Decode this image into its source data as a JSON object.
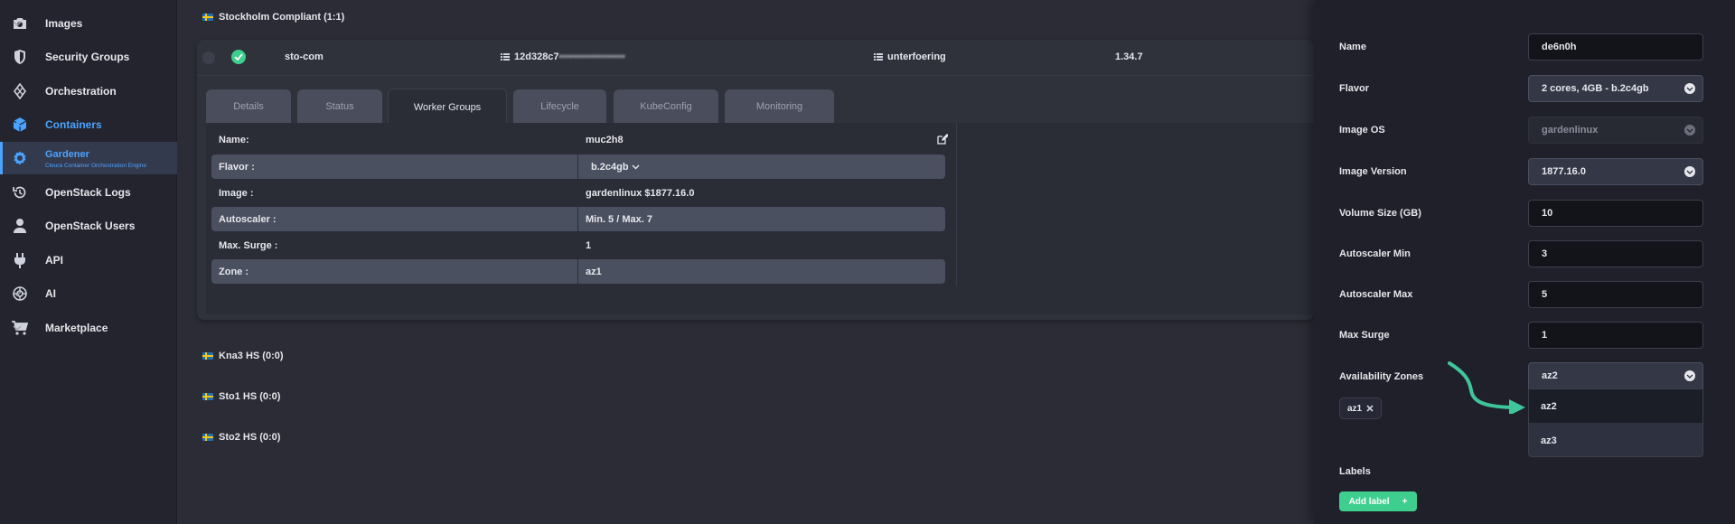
{
  "sidebar": {
    "items": [
      {
        "label": "Images",
        "icon": "camera-icon",
        "chevron": "down"
      },
      {
        "label": "Security Groups",
        "icon": "shield-icon"
      },
      {
        "label": "Orchestration",
        "icon": "orchestration-icon"
      },
      {
        "label": "Containers",
        "icon": "containers-icon",
        "chevron": "up",
        "accent": true
      },
      {
        "label": "Gardener",
        "sublabel": "Cleura Container Orchestration Engine",
        "icon": "gardener-icon",
        "active": true
      },
      {
        "label": "OpenStack Logs",
        "icon": "history-icon"
      },
      {
        "label": "OpenStack Users",
        "icon": "user-icon"
      },
      {
        "label": "API",
        "icon": "plug-icon"
      },
      {
        "label": "AI",
        "icon": "ai-icon",
        "chevron": "down"
      },
      {
        "label": "Marketplace",
        "icon": "cart-icon",
        "chevron": "down"
      }
    ]
  },
  "main": {
    "groups": [
      {
        "label": "Stockholm Compliant (1:1)"
      },
      {
        "label": "Kna3 HS (0:0)"
      },
      {
        "label": "Sto1 HS (0:0)"
      },
      {
        "label": "Sto2 HS (0:0)"
      }
    ],
    "cluster": {
      "name": "sto-com",
      "id_prefix": "12d328c7",
      "id_obscured": "•••••••••••••••••••",
      "project": "unterfoering",
      "version": "1.34.7"
    },
    "tabs": [
      "Details",
      "Status",
      "Worker Groups",
      "Lifecycle",
      "KubeConfig",
      "Monitoring"
    ],
    "active_tab": "Worker Groups",
    "worker_group": {
      "rows": [
        {
          "key": "Name:",
          "value": "muc2h8"
        },
        {
          "key": "Flavor :",
          "value": "b.2c4gb"
        },
        {
          "key": "Image :",
          "value": "gardenlinux $1877.16.0"
        },
        {
          "key": "Autoscaler :",
          "value": "Min. 5 / Max. 7"
        },
        {
          "key": "Max. Surge :",
          "value": "1"
        },
        {
          "key": "Zone :",
          "value": "az1"
        }
      ]
    }
  },
  "drawer": {
    "fields": [
      {
        "label": "Name",
        "value": "de6n0h",
        "type": "text"
      },
      {
        "label": "Flavor",
        "value": "2 cores, 4GB - b.2c4gb",
        "type": "select"
      },
      {
        "label": "Image OS",
        "value": "gardenlinux",
        "type": "disabled"
      },
      {
        "label": "Image Version",
        "value": "1877.16.0",
        "type": "select"
      },
      {
        "label": "Volume Size (GB)",
        "value": "10",
        "type": "text"
      },
      {
        "label": "Autoscaler Min",
        "value": "3",
        "type": "text"
      },
      {
        "label": "Autoscaler Max",
        "value": "5",
        "type": "text"
      },
      {
        "label": "Max Surge",
        "value": "1",
        "type": "text"
      },
      {
        "label": "Availability Zones",
        "value": "az2",
        "type": "select"
      }
    ],
    "zone_options": [
      "az2",
      "az3"
    ],
    "selected_zones": [
      "az1"
    ],
    "labels_heading": "Labels",
    "add_label_button": "Add label",
    "add_label_plus": "+"
  },
  "colors": {
    "accent": "#4aa3ff",
    "success": "#3ecf8e",
    "sidebar_bg": "#23242d",
    "drawer_bg": "#1f2029"
  }
}
